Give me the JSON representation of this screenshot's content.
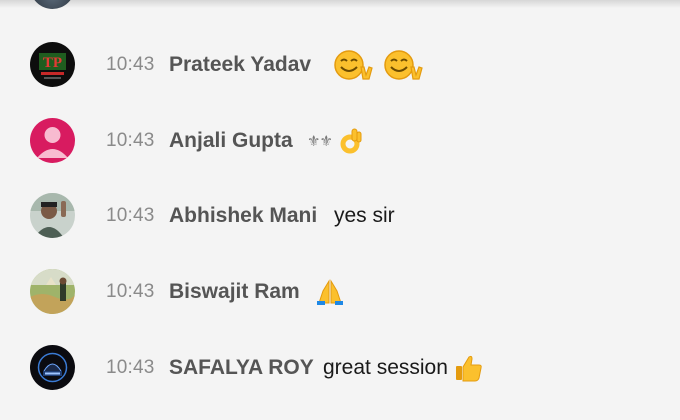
{
  "messages": [
    {
      "time": "10:43",
      "author": "Prateek Yadav",
      "text": "",
      "avatar_icon": "tp-logo-avatar",
      "emoji": [
        "smile-victory-emoji",
        "smile-victory-emoji"
      ]
    },
    {
      "time": "10:43",
      "author": "Anjali Gupta",
      "text": "",
      "symbols": "⚜⚜",
      "avatar_icon": "default-person-avatar",
      "avatar_color": "#d81b60",
      "emoji": [
        "ok-hand-emoji"
      ]
    },
    {
      "time": "10:43",
      "author": "Abhishek Mani",
      "text": "yes sir",
      "avatar_icon": "photo-person-avatar",
      "emoji": []
    },
    {
      "time": "10:43",
      "author": "Biswajit Ram",
      "text": "",
      "avatar_icon": "photo-outdoor-avatar",
      "emoji": [
        "folded-hands-emoji"
      ]
    },
    {
      "time": "10:43",
      "author": "SAFALYA ROY",
      "text": "great session",
      "avatar_icon": "dark-logo-avatar",
      "emoji": [
        "thumbs-up-emoji"
      ]
    }
  ],
  "colors": {
    "background": "#f4f4f4",
    "author": "#555555",
    "time": "#8a8a8a",
    "emoji_yellow": "#fbc02d"
  }
}
